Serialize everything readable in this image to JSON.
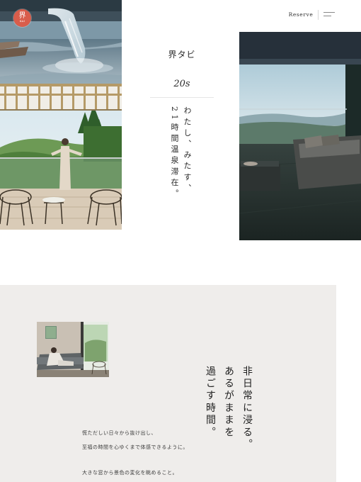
{
  "header": {
    "logo_kanji": "界",
    "logo_sub": "KAI",
    "reserve_label": "Reserve",
    "menu_icon": "hamburger-menu-icon"
  },
  "hero": {
    "brand_name": "界タビ",
    "brand_year": "20s",
    "tagline_lines": [
      "わたし、みたす、",
      "21時間温泉滞在。"
    ]
  },
  "section": {
    "heading_lines": [
      "非日常に浸る。",
      "あるがままを",
      "過ごす時間。"
    ],
    "body_lines": [
      "慌ただしい日々から抜け出し、",
      "至福の時間を心ゆくまで体感できるように。",
      "大きな窓から景色の変化を眺めること。"
    ]
  },
  "colors": {
    "logo": "#d95d4b",
    "section_background": "#efedeb",
    "text": "#2b2b2b"
  }
}
